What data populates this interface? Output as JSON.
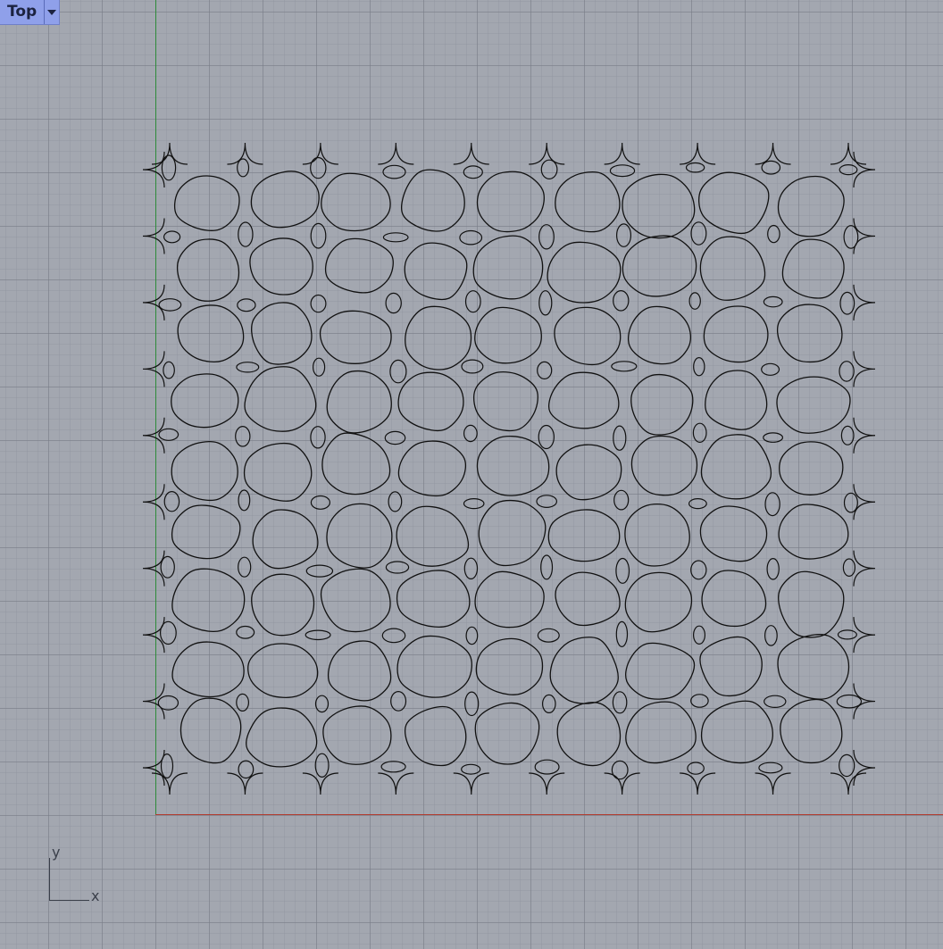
{
  "viewport": {
    "name": "Top",
    "axis_labels": {
      "y": "y",
      "x": "x"
    }
  },
  "colors": {
    "background": "#a3a7b0",
    "grid_minor": "#8c909a",
    "grid_major": "#787c86",
    "axis_x": "#b23a2e",
    "axis_y": "#2e8a3a",
    "curve": "#111111",
    "tab_bg": "#8fa0ea"
  },
  "icons": {
    "dropdown": "chevron-down-icon"
  }
}
